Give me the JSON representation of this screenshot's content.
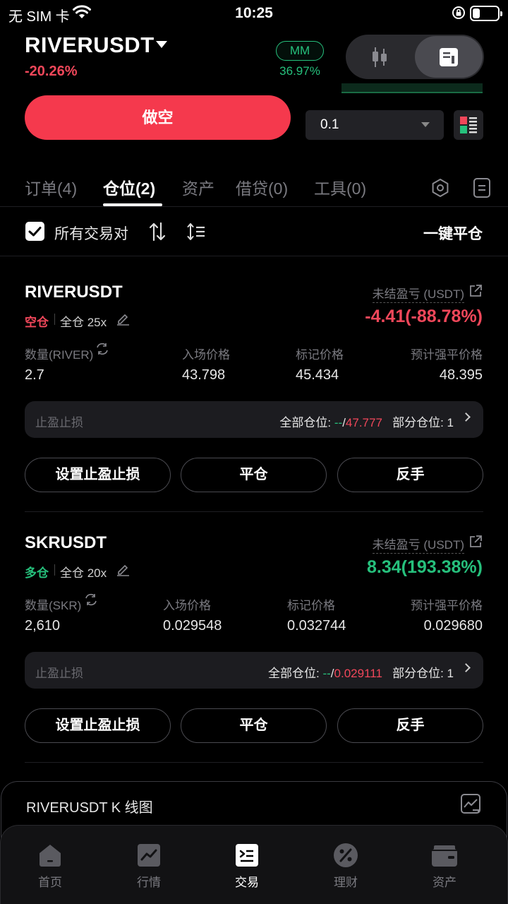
{
  "status_bar": {
    "carrier": "无 SIM 卡",
    "time": "10:25"
  },
  "header": {
    "symbol": "RIVERUSDT",
    "change": "-20.26%",
    "mm_label": "MM",
    "mm_value": "36.97%"
  },
  "order_panel": {
    "short_button": "做空",
    "quantity": "0.1"
  },
  "tabs": [
    {
      "label": "订单(4)"
    },
    {
      "label": "仓位(2)",
      "active": true
    },
    {
      "label": "资产"
    },
    {
      "label": "借贷(0)"
    },
    {
      "label": "工具(0)"
    }
  ],
  "filter": {
    "all_pairs_label": "所有交易对",
    "close_all_label": "一键平仓"
  },
  "positions": [
    {
      "symbol": "RIVERUSDT",
      "side": "空仓",
      "margin": "全仓 25x",
      "pnl_label": "未结盈亏 (USDT)",
      "pnl": "-4.41(-88.78%)",
      "qty_label": "数量(RIVER)",
      "entry_label": "入场价格",
      "mark_label": "标记价格",
      "liq_label": "预计强平价格",
      "qty": "2.7",
      "entry": "43.798",
      "mark": "45.434",
      "liq": "48.395",
      "tpsl_label": "止盈止损",
      "all_pos_label": "全部仓位: ",
      "tp": "--",
      "slash": "/",
      "sl": "47.777",
      "partial_label": "部分仓位: 1",
      "btn_tpsl": "设置止盈止损",
      "btn_close": "平仓",
      "btn_reverse": "反手"
    },
    {
      "symbol": "SKRUSDT",
      "side": "多仓",
      "margin": "全仓 20x",
      "pnl_label": "未结盈亏 (USDT)",
      "pnl": "8.34(193.38%)",
      "qty_label": "数量(SKR)",
      "entry_label": "入场价格",
      "mark_label": "标记价格",
      "liq_label": "预计强平价格",
      "qty": "2,610",
      "entry": "0.029548",
      "mark": "0.032744",
      "liq": "0.029680",
      "tpsl_label": "止盈止损",
      "all_pos_label": "全部仓位: ",
      "tp": "--",
      "slash": "/",
      "sl": "0.029111",
      "partial_label": "部分仓位: 1",
      "btn_tpsl": "设置止盈止损",
      "btn_close": "平仓",
      "btn_reverse": "反手"
    }
  ],
  "kline_sheet": {
    "title": "RIVERUSDT K 线图"
  },
  "bottom_nav": [
    {
      "label": "首页",
      "icon": "home-icon"
    },
    {
      "label": "行情",
      "icon": "chart-icon"
    },
    {
      "label": "交易",
      "icon": "trade-icon",
      "active": true
    },
    {
      "label": "理财",
      "icon": "percent-icon"
    },
    {
      "label": "资产",
      "icon": "wallet-icon"
    }
  ],
  "colors": {
    "red": "#f0475a",
    "green": "#26c07c",
    "orange": "#f39c3c",
    "short_button": "#f5394d"
  }
}
